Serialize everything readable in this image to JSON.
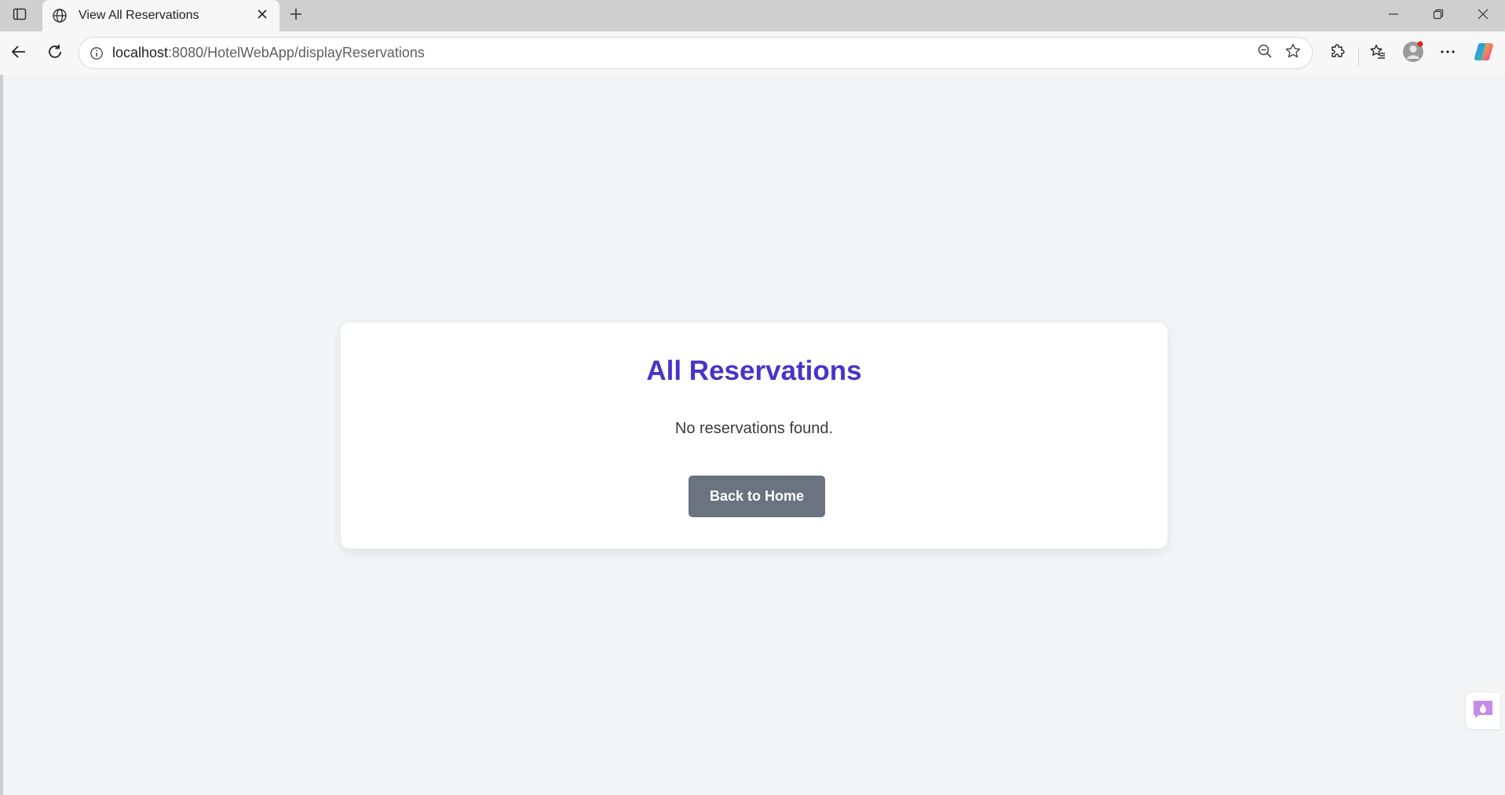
{
  "browser": {
    "tab_title": "View All Reservations",
    "url_host": "localhost",
    "url_path": ":8080/HotelWebApp/displayReservations"
  },
  "page": {
    "heading": "All Reservations",
    "empty_message": "No reservations found.",
    "back_button_label": "Back to Home"
  },
  "colors": {
    "heading": "#4834c7",
    "button_bg": "#6b7280",
    "page_bg": "#f3f4f6"
  },
  "icons": {
    "tab_actions": "tab-actions-icon",
    "globe": "globe-icon",
    "close": "close-icon",
    "new_tab": "plus-icon",
    "minimize": "minimize-icon",
    "restore": "restore-icon",
    "window_close": "window-close-icon",
    "back": "back-arrow-icon",
    "refresh": "refresh-icon",
    "site_info": "info-icon",
    "zoom": "zoom-out-icon",
    "favorite": "star-icon",
    "extensions": "puzzle-icon",
    "favorites": "favorites-icon",
    "profile": "avatar-icon",
    "more": "more-icon",
    "copilot": "copilot-icon"
  }
}
